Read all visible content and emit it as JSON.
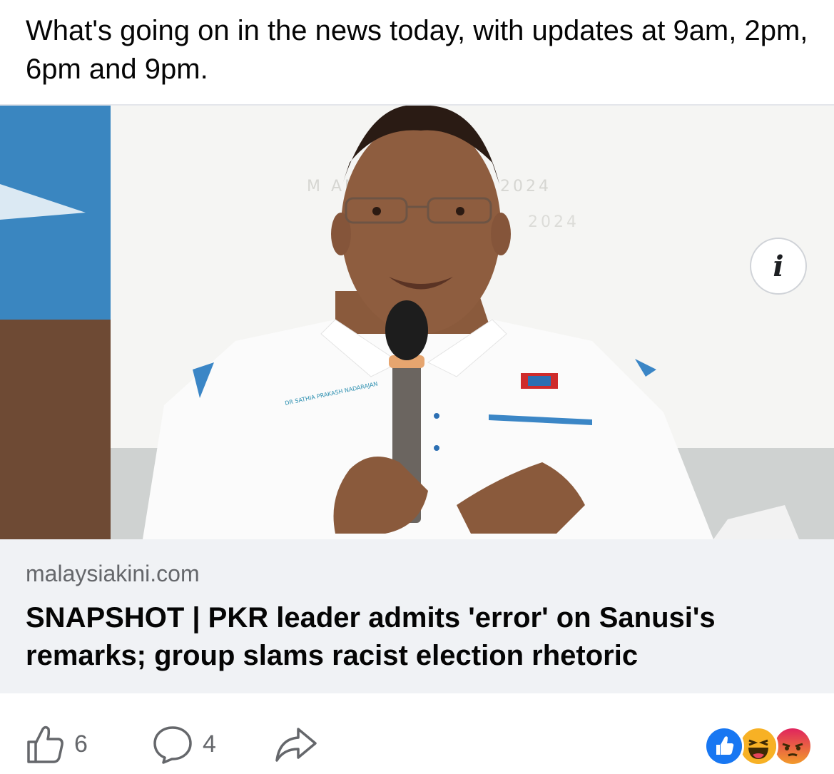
{
  "post": {
    "caption": "What's going on in the news today, with updates at 9am, 2pm, 6pm and 9pm."
  },
  "link_preview": {
    "image_alt": "PKR leader speaking into a microphone",
    "info_icon": "info-icon",
    "domain": "malaysiakini.com",
    "headline": "SNAPSHOT | PKR leader admits 'error' on Sanusi's remarks; group slams racist election rhetoric"
  },
  "actions": {
    "like_count": "6",
    "comment_count": "4",
    "like_icon": "thumbs-up-icon",
    "comment_icon": "comment-bubble-icon",
    "share_icon": "share-arrow-icon"
  },
  "reactions": [
    {
      "type": "like",
      "icon": "like-reaction-icon",
      "color": "#1877f2"
    },
    {
      "type": "haha",
      "icon": "haha-reaction-icon",
      "color": "#f7b125"
    },
    {
      "type": "angry",
      "icon": "angry-reaction-icon",
      "color": "#e9710f"
    }
  ]
}
